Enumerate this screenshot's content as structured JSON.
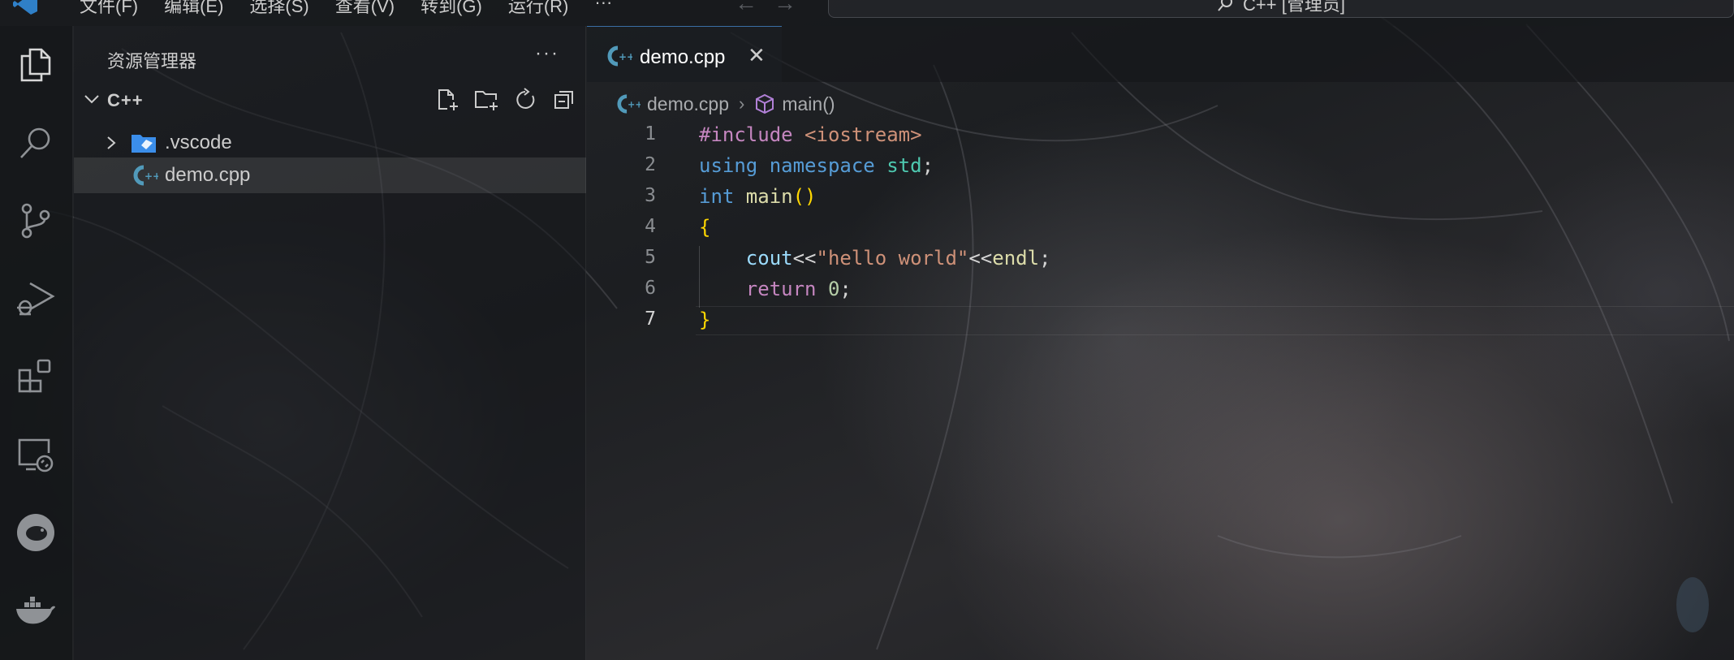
{
  "menu": {
    "items": [
      "文件(F)",
      "编辑(E)",
      "选择(S)",
      "查看(V)",
      "转到(G)",
      "运行(R)"
    ],
    "more": "···"
  },
  "command_center": {
    "text": "C++ [管理员]",
    "icon": "search-icon"
  },
  "activity_bar": {
    "icons": [
      "explorer-icon",
      "search-icon",
      "source-control-icon",
      "run-debug-icon",
      "extensions-icon",
      "remote-explorer-icon",
      "pig-extension-icon",
      "docker-icon"
    ]
  },
  "sidebar": {
    "title": "资源管理器",
    "more": "···",
    "folder": {
      "name": "C++",
      "actions": [
        "new-file-icon",
        "new-folder-icon",
        "refresh-icon",
        "collapse-all-icon"
      ]
    },
    "items": [
      {
        "label": ".vscode",
        "type": "folder",
        "expanded": false
      },
      {
        "label": "demo.cpp",
        "type": "cpp-file",
        "selected": true
      }
    ]
  },
  "tabs": [
    {
      "label": "demo.cpp",
      "active": true,
      "close": "✕"
    }
  ],
  "breadcrumb": {
    "file": "demo.cpp",
    "symbol": "main()"
  },
  "editor": {
    "current_line": 7,
    "lines": [
      {
        "n": "1",
        "tokens": [
          {
            "c": "t-pre",
            "t": "#include "
          },
          {
            "c": "t-inc",
            "t": "<iostream>"
          }
        ]
      },
      {
        "n": "2",
        "tokens": [
          {
            "c": "t-kw",
            "t": "using "
          },
          {
            "c": "t-kw",
            "t": "namespace "
          },
          {
            "c": "t-ns",
            "t": "std"
          },
          {
            "c": "t-op",
            "t": ";"
          }
        ]
      },
      {
        "n": "3",
        "tokens": [
          {
            "c": "t-kw",
            "t": "int "
          },
          {
            "c": "t-fn",
            "t": "main"
          },
          {
            "c": "t-br",
            "t": "()"
          }
        ]
      },
      {
        "n": "4",
        "tokens": [
          {
            "c": "t-br",
            "t": "{"
          }
        ]
      },
      {
        "n": "5",
        "tokens": [
          {
            "c": "t-op",
            "t": "    "
          },
          {
            "c": "t-var",
            "t": "cout"
          },
          {
            "c": "t-op",
            "t": "<<"
          },
          {
            "c": "t-str",
            "t": "\"hello world\""
          },
          {
            "c": "t-op",
            "t": "<<"
          },
          {
            "c": "t-fn",
            "t": "endl"
          },
          {
            "c": "t-op",
            "t": ";"
          }
        ]
      },
      {
        "n": "6",
        "tokens": [
          {
            "c": "t-op",
            "t": "    "
          },
          {
            "c": "t-kwc",
            "t": "return "
          },
          {
            "c": "t-num",
            "t": "0"
          },
          {
            "c": "t-op",
            "t": ";"
          }
        ]
      },
      {
        "n": "7",
        "tokens": [
          {
            "c": "t-br",
            "t": "}"
          }
        ]
      }
    ]
  },
  "colors": {
    "accent": "#3a6ea5",
    "cpp_icon": "#519aba",
    "vscode_folder": "#3b8eea"
  }
}
